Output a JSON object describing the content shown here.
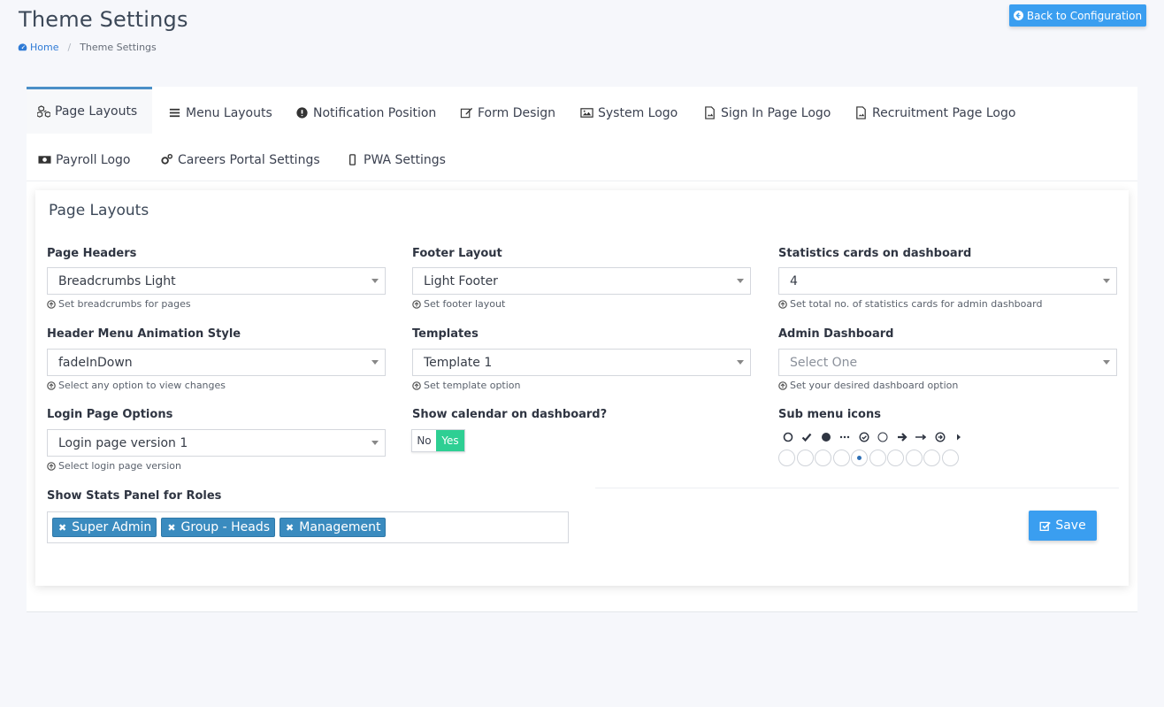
{
  "header": {
    "title": "Theme Settings",
    "breadcrumb": {
      "home": "Home",
      "current": "Theme Settings"
    },
    "back_button": "Back to Configuration"
  },
  "tabs": [
    {
      "label": "Page Layouts",
      "icon": "cubes-icon",
      "active": true
    },
    {
      "label": "Menu Layouts",
      "icon": "bars-icon",
      "active": false
    },
    {
      "label": "Notification Position",
      "icon": "exclamation-circle-icon",
      "active": false
    },
    {
      "label": "Form Design",
      "icon": "edit-icon",
      "active": false
    },
    {
      "label": "System Logo",
      "icon": "image-icon",
      "active": false
    },
    {
      "label": "Sign In Page Logo",
      "icon": "file-image-icon",
      "active": false
    },
    {
      "label": "Recruitment Page Logo",
      "icon": "file-image-icon",
      "active": false
    },
    {
      "label": "Payroll Logo",
      "icon": "money-icon",
      "active": false
    },
    {
      "label": "Careers Portal Settings",
      "icon": "cogs-icon",
      "active": false
    },
    {
      "label": "PWA Settings",
      "icon": "mobile-icon",
      "active": false
    }
  ],
  "card": {
    "title": "Page Layouts",
    "fields": {
      "page_headers": {
        "label": "Page Headers",
        "value": "Breadcrumbs Light",
        "hint": "Set breadcrumbs for pages"
      },
      "footer_layout": {
        "label": "Footer Layout",
        "value": "Light Footer",
        "hint": "Set footer layout"
      },
      "stats_cards": {
        "label": "Statistics cards on dashboard",
        "value": "4",
        "hint": "Set total no. of statistics cards for admin dashboard"
      },
      "header_animation": {
        "label": "Header Menu Animation Style",
        "value": "fadeInDown",
        "hint": "Select any option to view changes"
      },
      "templates": {
        "label": "Templates",
        "value": "Template 1",
        "hint": "Set template option"
      },
      "admin_dashboard": {
        "label": "Admin Dashboard",
        "placeholder": "Select One",
        "hint": "Set your desired dashboard option"
      },
      "login_options": {
        "label": "Login Page Options",
        "value": "Login page version 1",
        "hint": "Select login page version"
      },
      "show_calendar": {
        "label": "Show calendar on dashboard?",
        "off_label": "No",
        "on_label": "Yes",
        "value": "Yes"
      },
      "sub_menu_icons": {
        "label": "Sub menu icons",
        "icons": [
          "circle-outline-icon",
          "check-icon",
          "circle-filled-icon",
          "ellipsis-icon",
          "check-circle-icon",
          "circle-thin-icon",
          "arrow-right-icon",
          "long-arrow-right-icon",
          "arrow-circle-right-icon",
          "caret-right-icon"
        ],
        "selected_index": 4
      },
      "stats_roles": {
        "label": "Show Stats Panel for Roles",
        "tags": [
          "Super Admin",
          "Group - Heads",
          "Management"
        ]
      }
    },
    "save_button": "Save"
  },
  "colors": {
    "accent": "#3a9ef0",
    "tab_active_border": "#4a8fc7",
    "toggle_on": "#2ecf93",
    "tag_bg": "#3a8bbf"
  }
}
